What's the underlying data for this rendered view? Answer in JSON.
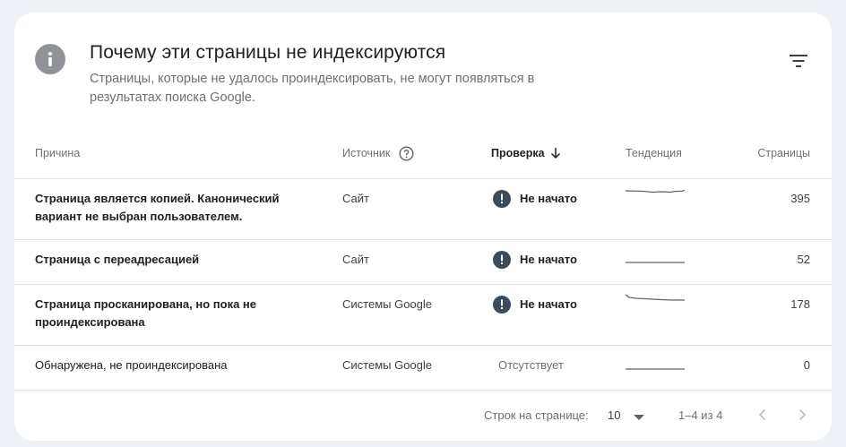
{
  "header": {
    "title": "Почему эти страницы не индексируются",
    "subtitle": "Страницы, которые не удалось проиндексировать, не могут появляться в результатах поиска Google."
  },
  "icons": {
    "info": "info-icon",
    "filter": "filter-icon",
    "help": "help-circle-icon",
    "sort": "arrow-down-icon",
    "warning": "exclamation-circle-icon",
    "prev": "chevron-left-icon",
    "next": "chevron-right-icon"
  },
  "columns": {
    "reason": "Причина",
    "source": "Источник",
    "check": "Проверка",
    "trend": "Тенденция",
    "pages": "Страницы"
  },
  "rows": [
    {
      "reason": "Страница является копией. Канонический вариант не выбран пользователем.",
      "source": "Сайт",
      "check": "Не начато",
      "pages": "395"
    },
    {
      "reason": "Страница с переадресацией",
      "source": "Сайт",
      "check": "Не начато",
      "pages": "52"
    },
    {
      "reason": "Страница просканирована, но пока не проиндексирована",
      "source": "Системы Google",
      "check": "Не начато",
      "pages": "178"
    },
    {
      "reason": "Обнаружена, не проиндексирована",
      "source": "Системы Google",
      "check": "Отсутствует",
      "pages": "0"
    }
  ],
  "footer": {
    "rows_per_page_label": "Строк на странице:",
    "rows_per_page_value": "10",
    "range": "1–4 из 4"
  },
  "colors": {
    "background": "#eef1f6",
    "card": "#ffffff",
    "warning_badge": "#3c4a5a",
    "info_badge": "#8f9297"
  }
}
